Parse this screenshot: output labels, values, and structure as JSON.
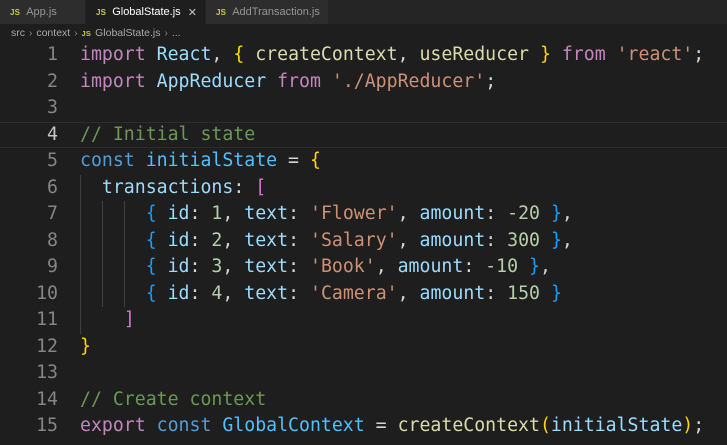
{
  "tabs": [
    {
      "icon": "JS",
      "label": "App.js",
      "active": false
    },
    {
      "icon": "JS",
      "label": "GlobalState.js",
      "active": true,
      "close": "✕"
    },
    {
      "icon": "JS",
      "label": "AddTransaction.js",
      "active": false
    }
  ],
  "breadcrumb": {
    "items": [
      "src",
      "context"
    ],
    "file_icon": "JS",
    "file": "GlobalState.js",
    "trailing": "..."
  },
  "colors": {
    "keyword": "#c586c0",
    "storage": "#569cd6",
    "variable": "#9cdcfe",
    "constant": "#4fc1ff",
    "function": "#dcdcaa",
    "string": "#ce9178",
    "number": "#b5cea8",
    "comment": "#6a9955",
    "bracket_level1": "#ffd700",
    "bracket_level2": "#da70d6",
    "bracket_level3": "#179fff"
  },
  "editor": {
    "current_line": 4,
    "lines": [
      {
        "n": "1",
        "tokens": [
          [
            "kw",
            "import"
          ],
          [
            "pl",
            " "
          ],
          [
            "var",
            "React"
          ],
          [
            "pl",
            ", "
          ],
          [
            "b1",
            "{"
          ],
          [
            "pl",
            " "
          ],
          [
            "fn",
            "createContext"
          ],
          [
            "pl",
            ", "
          ],
          [
            "fn",
            "useReducer"
          ],
          [
            "pl",
            " "
          ],
          [
            "b1",
            "}"
          ],
          [
            "pl",
            " "
          ],
          [
            "kw",
            "from"
          ],
          [
            "pl",
            " "
          ],
          [
            "str",
            "'react'"
          ],
          [
            "pl",
            ";"
          ]
        ]
      },
      {
        "n": "2",
        "tokens": [
          [
            "kw",
            "import"
          ],
          [
            "pl",
            " "
          ],
          [
            "var",
            "AppReducer"
          ],
          [
            "pl",
            " "
          ],
          [
            "kw",
            "from"
          ],
          [
            "pl",
            " "
          ],
          [
            "str",
            "'./AppReducer'"
          ],
          [
            "pl",
            ";"
          ]
        ]
      },
      {
        "n": "3",
        "tokens": []
      },
      {
        "n": "4",
        "tokens": [
          [
            "cmt",
            "// Initial state"
          ]
        ]
      },
      {
        "n": "5",
        "tokens": [
          [
            "st",
            "const"
          ],
          [
            "pl",
            " "
          ],
          [
            "cst",
            "initialState"
          ],
          [
            "pl",
            " = "
          ],
          [
            "b1",
            "{"
          ]
        ]
      },
      {
        "n": "6",
        "tokens": [
          [
            "pl",
            "  "
          ],
          [
            "var",
            "transactions"
          ],
          [
            "pl",
            ": "
          ],
          [
            "b2",
            "["
          ]
        ]
      },
      {
        "n": "7",
        "tokens": [
          [
            "pl",
            "      "
          ],
          [
            "b3",
            "{"
          ],
          [
            "pl",
            " "
          ],
          [
            "var",
            "id"
          ],
          [
            "pl",
            ": "
          ],
          [
            "num",
            "1"
          ],
          [
            "pl",
            ", "
          ],
          [
            "var",
            "text"
          ],
          [
            "pl",
            ": "
          ],
          [
            "str",
            "'Flower'"
          ],
          [
            "pl",
            ", "
          ],
          [
            "var",
            "amount"
          ],
          [
            "pl",
            ": "
          ],
          [
            "num",
            "-20"
          ],
          [
            "pl",
            " "
          ],
          [
            "b3",
            "}"
          ],
          [
            "pl",
            ","
          ]
        ]
      },
      {
        "n": "8",
        "tokens": [
          [
            "pl",
            "      "
          ],
          [
            "b3",
            "{"
          ],
          [
            "pl",
            " "
          ],
          [
            "var",
            "id"
          ],
          [
            "pl",
            ": "
          ],
          [
            "num",
            "2"
          ],
          [
            "pl",
            ", "
          ],
          [
            "var",
            "text"
          ],
          [
            "pl",
            ": "
          ],
          [
            "str",
            "'Salary'"
          ],
          [
            "pl",
            ", "
          ],
          [
            "var",
            "amount"
          ],
          [
            "pl",
            ": "
          ],
          [
            "num",
            "300"
          ],
          [
            "pl",
            " "
          ],
          [
            "b3",
            "}"
          ],
          [
            "pl",
            ","
          ]
        ]
      },
      {
        "n": "9",
        "tokens": [
          [
            "pl",
            "      "
          ],
          [
            "b3",
            "{"
          ],
          [
            "pl",
            " "
          ],
          [
            "var",
            "id"
          ],
          [
            "pl",
            ": "
          ],
          [
            "num",
            "3"
          ],
          [
            "pl",
            ", "
          ],
          [
            "var",
            "text"
          ],
          [
            "pl",
            ": "
          ],
          [
            "str",
            "'Book'"
          ],
          [
            "pl",
            ", "
          ],
          [
            "var",
            "amount"
          ],
          [
            "pl",
            ": "
          ],
          [
            "num",
            "-10"
          ],
          [
            "pl",
            " "
          ],
          [
            "b3",
            "}"
          ],
          [
            "pl",
            ","
          ]
        ]
      },
      {
        "n": "10",
        "tokens": [
          [
            "pl",
            "      "
          ],
          [
            "b3",
            "{"
          ],
          [
            "pl",
            " "
          ],
          [
            "var",
            "id"
          ],
          [
            "pl",
            ": "
          ],
          [
            "num",
            "4"
          ],
          [
            "pl",
            ", "
          ],
          [
            "var",
            "text"
          ],
          [
            "pl",
            ": "
          ],
          [
            "str",
            "'Camera'"
          ],
          [
            "pl",
            ", "
          ],
          [
            "var",
            "amount"
          ],
          [
            "pl",
            ": "
          ],
          [
            "num",
            "150"
          ],
          [
            "pl",
            " "
          ],
          [
            "b3",
            "}"
          ]
        ]
      },
      {
        "n": "11",
        "tokens": [
          [
            "pl",
            "    "
          ],
          [
            "b2",
            "]"
          ]
        ]
      },
      {
        "n": "12",
        "tokens": [
          [
            "b1",
            "}"
          ]
        ]
      },
      {
        "n": "13",
        "tokens": []
      },
      {
        "n": "14",
        "tokens": [
          [
            "cmt",
            "// Create context"
          ]
        ]
      },
      {
        "n": "15",
        "tokens": [
          [
            "kw",
            "export"
          ],
          [
            "pl",
            " "
          ],
          [
            "st",
            "const"
          ],
          [
            "pl",
            " "
          ],
          [
            "cst",
            "GlobalContext"
          ],
          [
            "pl",
            " = "
          ],
          [
            "fn",
            "createContext"
          ],
          [
            "b1",
            "("
          ],
          [
            "var",
            "initialState"
          ],
          [
            "b1",
            ")"
          ],
          [
            "pl",
            ";"
          ]
        ]
      }
    ]
  }
}
